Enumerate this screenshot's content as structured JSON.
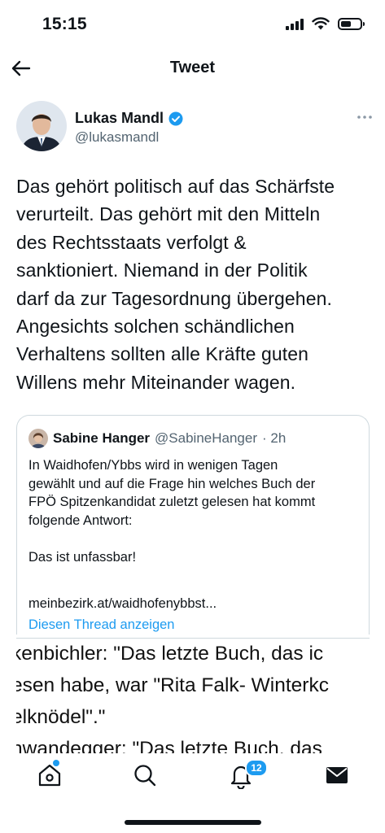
{
  "status_bar": {
    "time": "15:15",
    "icons": [
      "cellular-signal-icon",
      "wifi-icon",
      "battery-icon"
    ],
    "battery_level": 0.55
  },
  "header": {
    "title": "Tweet",
    "back_icon": "arrow-left-icon"
  },
  "tweet": {
    "author_name": "Lukas Mandl",
    "author_handle": "@lukasmandl",
    "verified": true,
    "text": "Das gehört politisch auf das Schärfste\nverurteilt. Das gehört mit den Mitteln\ndes Rechtsstaats verfolgt &\nsanktioniert. Niemand in der Politik\ndarf da zur Tagesordnung übergehen.\nAngesichts solchen schändlichen\nVerhaltens sollten alle Kräfte guten\nWillens mehr Miteinander wagen."
  },
  "quote": {
    "author_name": "Sabine Hanger",
    "author_handle": "@SabineHanger",
    "time": "· 2h",
    "text": "In Waidhofen/Ybbs wird in wenigen Tagen\ngewählt und auf die Frage hin welches Buch der\nFPÖ Spitzenkandidat zuletzt gelesen hat kommt\nfolgende Antwort:\n\nDas ist unfassbar!",
    "link": "meinbezirk.at/waidhofenybbst...",
    "thread_label": "Diesen Thread anzeigen"
  },
  "preview": {
    "lines": [
      "kenbichler: \"Das letzte Buch, das ic",
      "esen habe, war \"Rita Falk- Winterkc",
      "elknödel\".\"",
      "hwandegger: \"Das letzte Buch, das"
    ]
  },
  "tab_bar": {
    "notification_count": "12",
    "tabs": [
      "home-icon",
      "search-icon",
      "notifications-icon",
      "messages-icon"
    ]
  },
  "colors": {
    "accent": "#1d9bf0",
    "text": "#0f1419",
    "secondary_text": "#536471",
    "border": "#cfd9de"
  }
}
